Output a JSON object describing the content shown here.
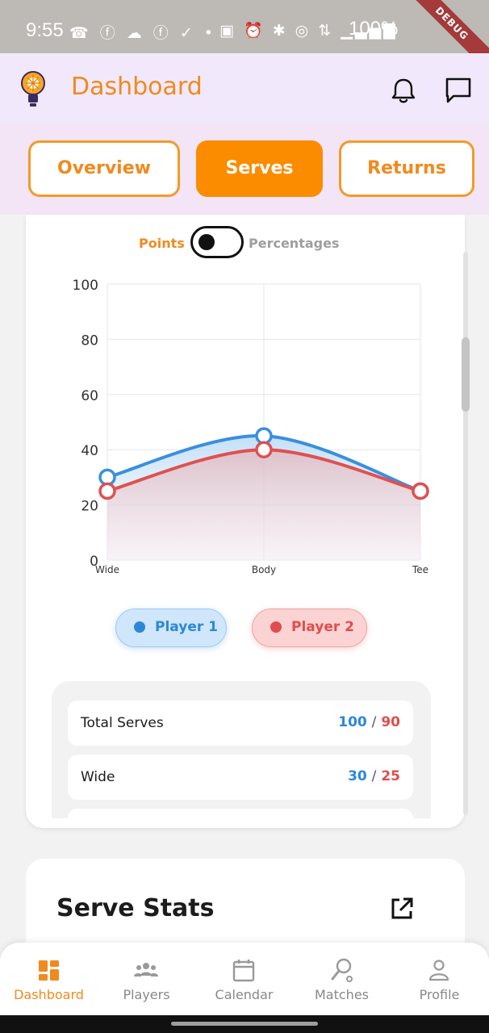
{
  "status_bar": {
    "time": "9:55",
    "left_icons": "☎ ⓕ ☁ ⓕ ✓ •",
    "right_icons": "▣ ⏰ ✱ ◎ ⇅ ▁▃▅▇",
    "battery": "100%",
    "debug_label": "DEBUG"
  },
  "app_bar": {
    "title": "Dashboard",
    "logo_icon": "lightbulb-logo-icon",
    "notification_icon": "bell-icon",
    "messages_icon": "chat-icon"
  },
  "tabs": [
    {
      "label": "Overview",
      "active": false
    },
    {
      "label": "Serves",
      "active": true
    },
    {
      "label": "Returns",
      "active": false
    }
  ],
  "chart_toggle": {
    "left_label": "Points",
    "right_label": "Percentages",
    "state": "points"
  },
  "chart_data": {
    "type": "line",
    "categories": [
      "Wide",
      "Body",
      "Tee"
    ],
    "y_ticks": [
      "100",
      "80",
      "60",
      "40",
      "20",
      "0"
    ],
    "ylim": [
      0,
      100
    ],
    "grid": true,
    "smooth": true,
    "series": [
      {
        "name": "Player 1",
        "values": [
          30,
          45,
          25
        ],
        "color": "#3a8fdf"
      },
      {
        "name": "Player 2",
        "values": [
          25,
          40,
          25
        ],
        "color": "#e05050"
      }
    ]
  },
  "legend": {
    "player1": "Player 1",
    "player2": "Player 2"
  },
  "stats": [
    {
      "label": "Total Serves",
      "p1": "100",
      "p2": "90"
    },
    {
      "label": "Wide",
      "p1": "30",
      "p2": "25"
    }
  ],
  "stats_separator": "/",
  "serve_stats_card": {
    "title": "Serve Stats",
    "action_icon": "open-external-icon"
  },
  "bottom_nav": [
    {
      "label": "Dashboard",
      "icon": "dashboard-icon",
      "active": true
    },
    {
      "label": "Players",
      "icon": "players-icon",
      "active": false
    },
    {
      "label": "Calendar",
      "icon": "calendar-icon",
      "active": false
    },
    {
      "label": "Matches",
      "icon": "matches-icon",
      "active": false
    },
    {
      "label": "Profile",
      "icon": "profile-icon",
      "active": false
    }
  ],
  "colors": {
    "accent": "#f08a1e",
    "active_tab": "#fb8c00",
    "player1": "#2d87d8",
    "player2": "#e04d4d"
  }
}
